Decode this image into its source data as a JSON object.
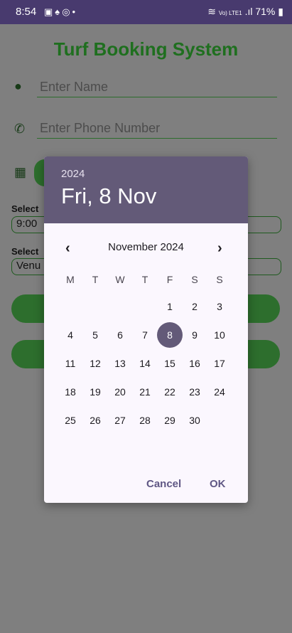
{
  "status_bar": {
    "time": "8:54",
    "notif_icons": [
      "gallery-icon",
      "snapchat-icon",
      "whatsapp-icon",
      "dot-icon"
    ],
    "battery": "71%",
    "network": "Vo) LTE1"
  },
  "app": {
    "title": "Turf Booking System",
    "name_placeholder": "Enter Name",
    "phone_placeholder": "Enter Phone Number",
    "select_time_label": "Select",
    "time_value": "9:00",
    "select_venue_label": "Select",
    "venue_value": "Venu"
  },
  "date_picker": {
    "year": "2024",
    "selected_date": "Fri, 8 Nov",
    "month_year": "November 2024",
    "weekdays": [
      "M",
      "T",
      "W",
      "T",
      "F",
      "S",
      "S"
    ],
    "weeks": [
      [
        "",
        "",
        "",
        "",
        "1",
        "2",
        "3"
      ],
      [
        "4",
        "5",
        "6",
        "7",
        "8",
        "9",
        "10"
      ],
      [
        "11",
        "12",
        "13",
        "14",
        "15",
        "16",
        "17"
      ],
      [
        "18",
        "19",
        "20",
        "21",
        "22",
        "23",
        "24"
      ],
      [
        "25",
        "26",
        "27",
        "28",
        "29",
        "30",
        ""
      ]
    ],
    "selected_day": "8",
    "cancel_label": "Cancel",
    "ok_label": "OK"
  },
  "colors": {
    "status_bar": "#483a6e",
    "scrim_background": "#7f7f7f",
    "title_green": "#1f6f1f",
    "header": "#635a78",
    "dialog_bg": "#fbf7fe",
    "accent_text": "#5f5784"
  }
}
